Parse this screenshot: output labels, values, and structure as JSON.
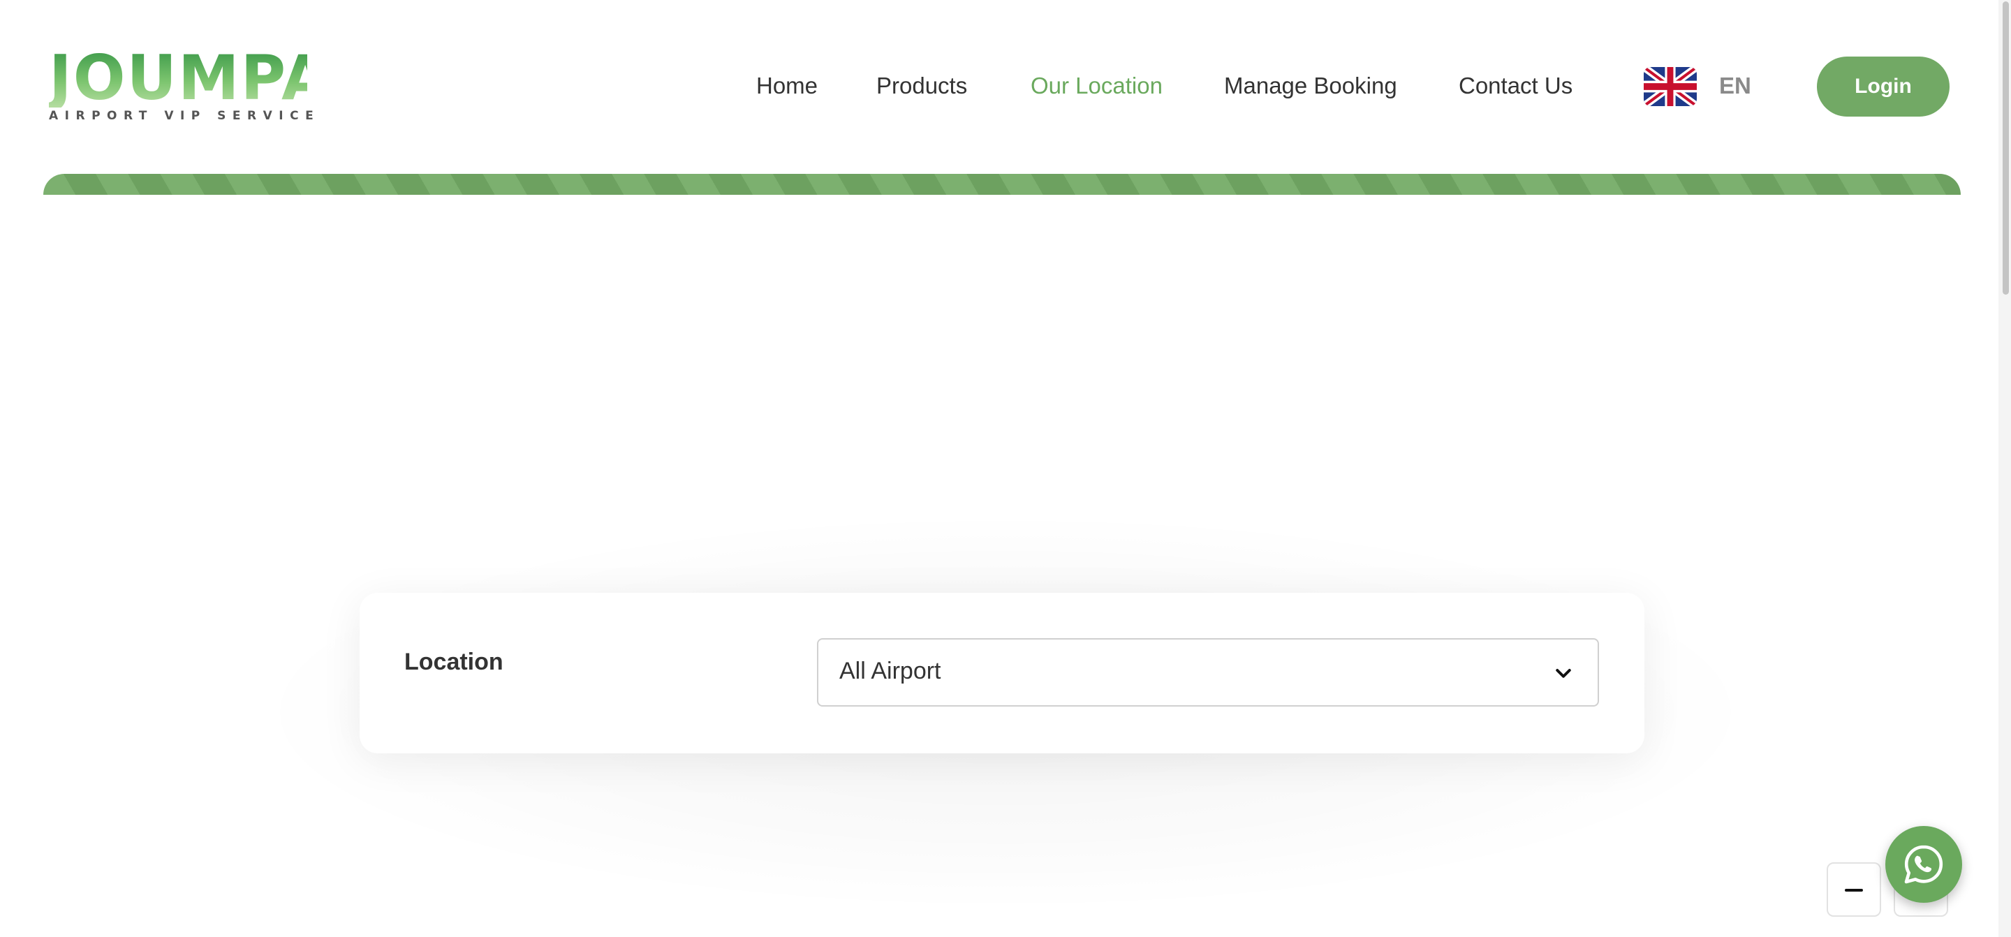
{
  "brand": {
    "name": "JOUMPA",
    "tagline": "AIRPORT VIP SERVICE",
    "color": "#6aa95d"
  },
  "nav": {
    "items": [
      {
        "label": "Home",
        "active": false
      },
      {
        "label": "Products",
        "active": false
      },
      {
        "label": "Our Location",
        "active": true
      },
      {
        "label": "Manage Booking",
        "active": false
      },
      {
        "label": "Contact Us",
        "active": false
      }
    ],
    "language": {
      "flag_icon": "uk-flag-icon",
      "code": "EN"
    },
    "login_label": "Login"
  },
  "location_filter": {
    "label": "Location",
    "select": {
      "value": "All Airport",
      "icon": "chevron-down-icon"
    }
  },
  "floating": {
    "whatsapp_icon": "whatsapp-icon",
    "minimize_icon": "minus-icon"
  },
  "colors": {
    "accent": "#6aa95d",
    "button": "#72a965",
    "text": "#333333"
  }
}
